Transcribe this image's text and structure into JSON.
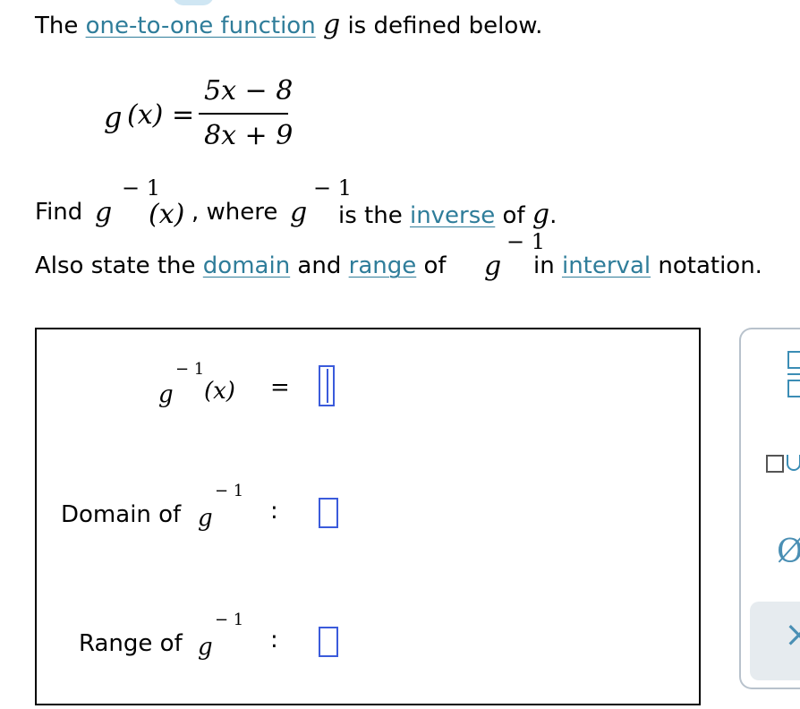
{
  "problem": {
    "line1": {
      "prefix": "The ",
      "link": "one-to-one function",
      "var": "g",
      "suffix": " is defined below."
    },
    "function_def": {
      "lhs": "g",
      "lhs_paren": "(x)",
      "equals": "=",
      "numerator": "5x − 8",
      "denominator": "8x + 9"
    },
    "line2": {
      "find": "Find ",
      "var": "g",
      "sup": "− 1",
      "arg": "(x)",
      "where": ", where ",
      "var2": "g",
      "sup2": "− 1",
      "is_the": " is the ",
      "link": "inverse",
      "of": " of ",
      "var3": "g",
      "end": "."
    },
    "line3": {
      "also": "Also state the ",
      "link_domain": "domain",
      "and": " and ",
      "link_range": "range",
      "of": " of ",
      "var": "g",
      "sup": "− 1",
      "in": " in ",
      "link_interval": "interval",
      "notation": " notation."
    }
  },
  "answer": {
    "inverse_row": {
      "var": "g",
      "sup": "− 1",
      "arg": "(x)",
      "equals": "="
    },
    "domain_row": {
      "label": "Domain of ",
      "var": "g",
      "sup": "− 1",
      "colon": ":"
    },
    "range_row": {
      "label": "Range of ",
      "var": "g",
      "sup": "− 1",
      "colon": ":"
    }
  },
  "toolbar": {
    "fraction_icon": "fraction-icon",
    "union_icon": "union-icon",
    "empty_set_symbol": "Ø",
    "empty_set_icon": "empty-set-icon",
    "close_symbol": "×",
    "close_icon": "close-icon"
  }
}
